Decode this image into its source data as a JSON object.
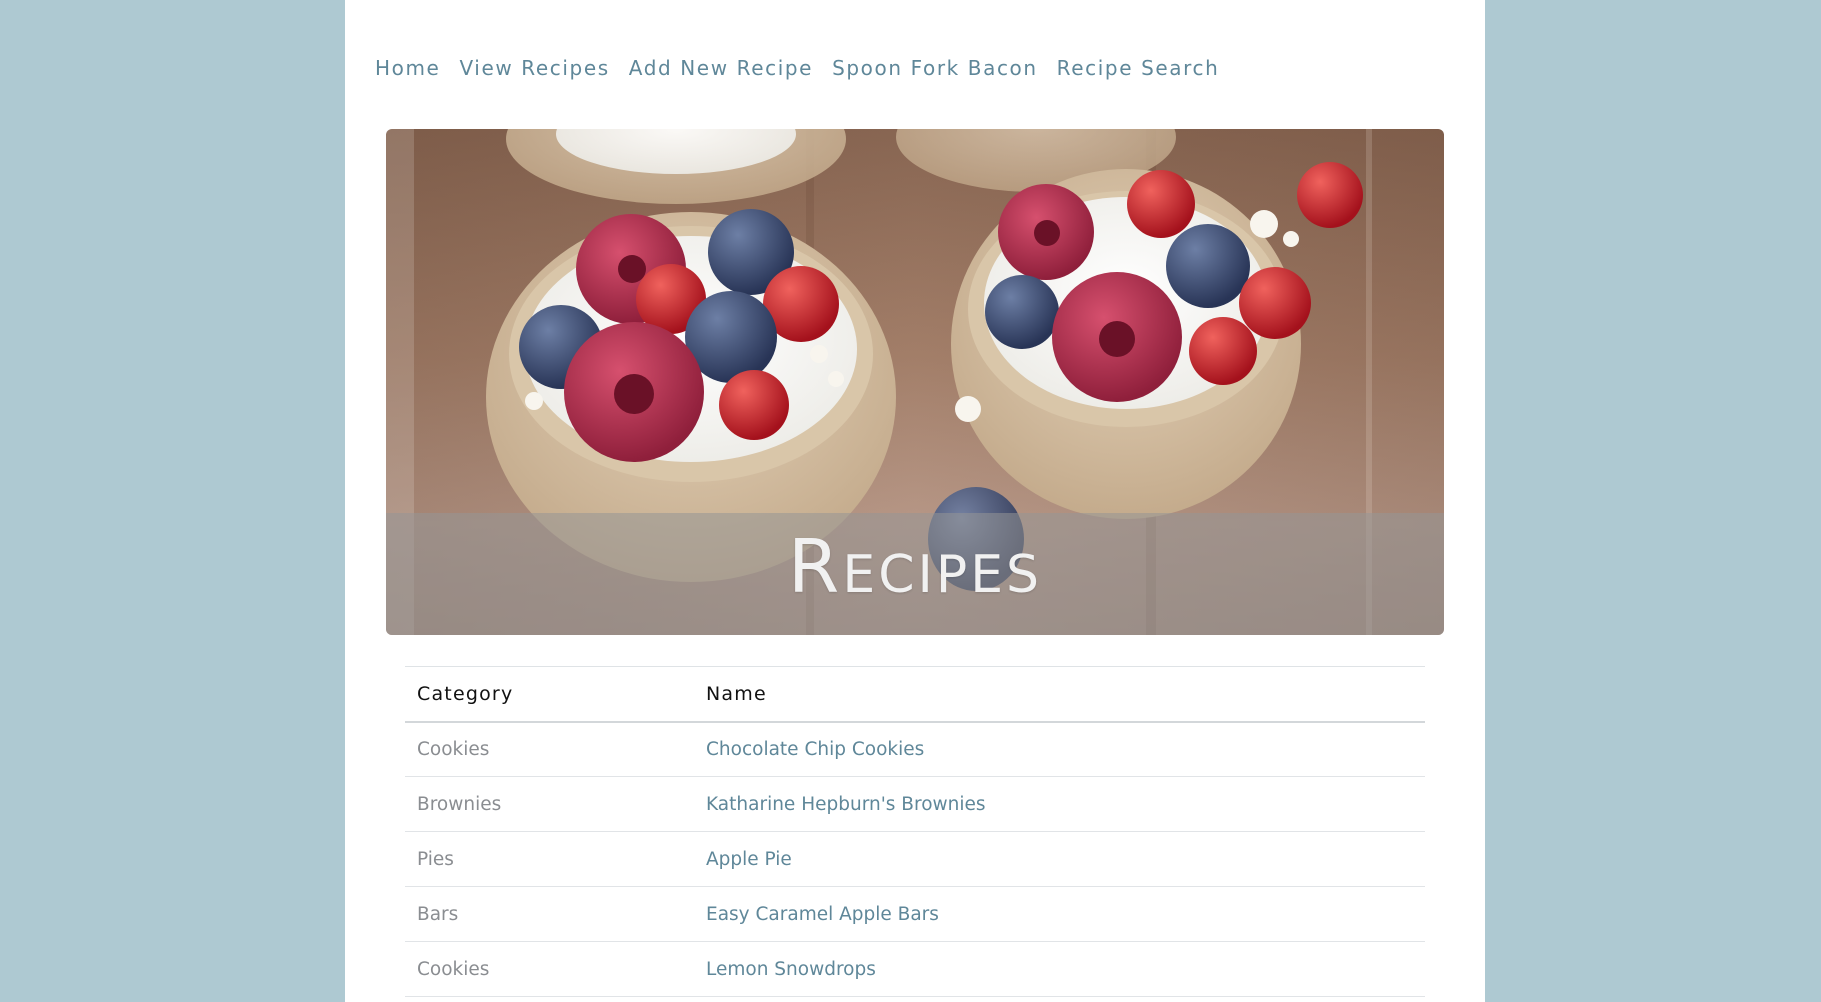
{
  "nav": {
    "items": [
      {
        "label": "Home"
      },
      {
        "label": "View Recipes"
      },
      {
        "label": "Add New Recipe"
      },
      {
        "label": "Spoon Fork Bacon"
      },
      {
        "label": "Recipe Search"
      }
    ]
  },
  "hero": {
    "title": "Recipes"
  },
  "table": {
    "headers": {
      "category": "Category",
      "name": "Name"
    },
    "rows": [
      {
        "category": "Cookies",
        "name": "Chocolate Chip Cookies"
      },
      {
        "category": "Brownies",
        "name": "Katharine Hepburn's Brownies"
      },
      {
        "category": "Pies",
        "name": "Apple Pie"
      },
      {
        "category": "Bars",
        "name": "Easy Caramel Apple Bars"
      },
      {
        "category": "Cookies",
        "name": "Lemon Snowdrops"
      }
    ]
  },
  "colors": {
    "background": "#aec9d2",
    "page": "#ffffff",
    "accent": "#5f8799",
    "muted_text": "#8a8d91"
  },
  "icons": {
    "hero_image": "berry-tart-photo"
  }
}
